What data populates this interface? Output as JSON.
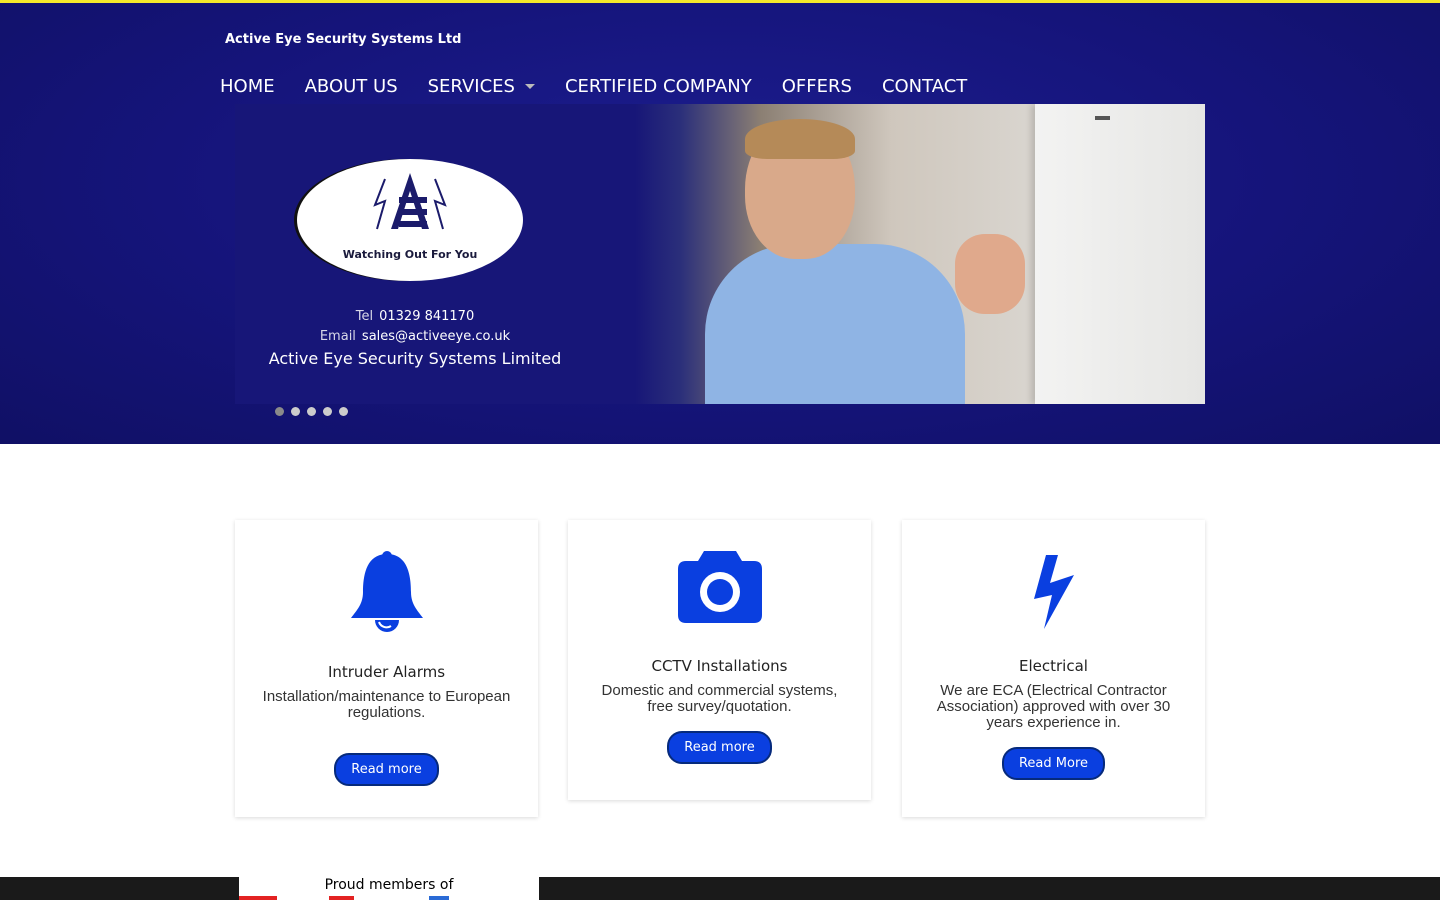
{
  "header": {
    "site_title": "Active Eye Security Systems Ltd",
    "nav": [
      {
        "label": "HOME"
      },
      {
        "label": "ABOUT US"
      },
      {
        "label": "SERVICES",
        "has_dropdown": true
      },
      {
        "label": "CERTIFIED COMPANY"
      },
      {
        "label": "OFFERS"
      },
      {
        "label": "CONTACT"
      }
    ]
  },
  "slider": {
    "logo_tagline": "Watching Out For You",
    "tel_label": "Tel",
    "tel_value": "01329 841170",
    "email_label": "Email",
    "email_value": "sales@activeeye.co.uk",
    "company_name": "Active Eye Security Systems Limited",
    "slide_count": 5,
    "active_slide": 1
  },
  "services": [
    {
      "title": "Intruder Alarms",
      "description": "Installation/maintenance to European regulations.",
      "button": "Read more",
      "icon": "bell-icon"
    },
    {
      "title": "CCTV Installations",
      "description": "Domestic and commercial systems, free survey/quotation.",
      "button": "Read more",
      "icon": "camera-icon"
    },
    {
      "title": "Electrical",
      "description": "We are ECA (Electrical Contractor Association) approved with over 30 years experience in.",
      "button": "Read More",
      "icon": "lightning-icon"
    }
  ],
  "footer": {
    "proud_members": "Proud members of"
  },
  "colors": {
    "header_bg": "#15147a",
    "accent_blue": "#0a3fe0",
    "top_stripe": "#f5e92a"
  }
}
